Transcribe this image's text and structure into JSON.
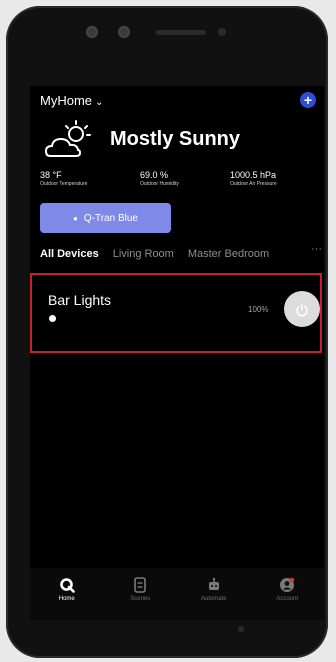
{
  "header": {
    "home_name": "MyHome",
    "add_label": "+"
  },
  "weather": {
    "condition": "Mostly Sunny",
    "icon": "partly-sunny-icon",
    "stats": [
      {
        "value": "38 °F",
        "label": "Outdoor Temperature"
      },
      {
        "value": "69.0 %",
        "label": "Outdoor Humidity"
      },
      {
        "value": "1000.5 hPa",
        "label": "Outdoor Air Pressure"
      }
    ]
  },
  "hub_button": {
    "label": "Q-Tran Blue"
  },
  "tabs": [
    {
      "label": "All Devices",
      "active": true
    },
    {
      "label": "Living Room",
      "active": false
    },
    {
      "label": "Master Bedroom",
      "active": false
    }
  ],
  "tabs_more": "···",
  "devices": [
    {
      "name": "Bar Lights",
      "level": "100%",
      "on": true
    }
  ],
  "bottom_nav": [
    {
      "label": "Home",
      "icon": "home-q-icon",
      "active": true
    },
    {
      "label": "Scenes",
      "icon": "scenes-icon",
      "active": false
    },
    {
      "label": "Automate",
      "icon": "robot-icon",
      "active": false
    },
    {
      "label": "Account",
      "icon": "account-icon",
      "active": false
    }
  ],
  "colors": {
    "accent_blue": "#2f4dd8",
    "hub_button": "#7f89e8",
    "highlight_border": "#c71f2d"
  }
}
